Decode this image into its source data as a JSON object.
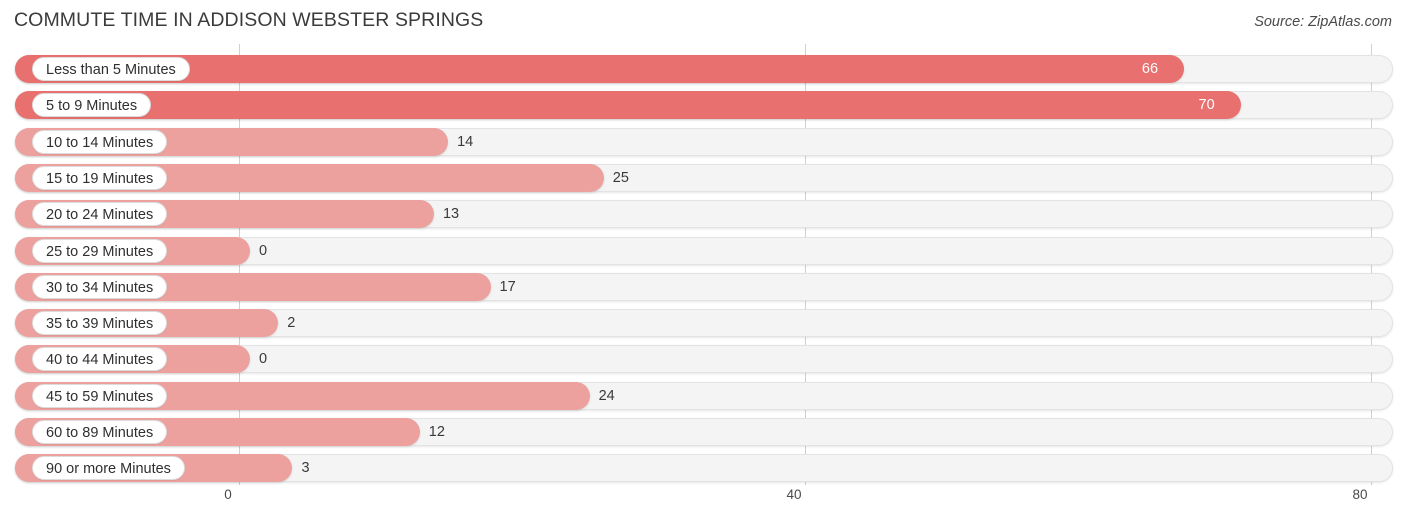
{
  "header": {
    "title": "COMMUTE TIME IN ADDISON WEBSTER SPRINGS",
    "source": "Source: ZipAtlas.com"
  },
  "colors": {
    "bar_light": "#eda19e",
    "bar_dark": "#e8706e",
    "track": "#f4f4f4",
    "gridline": "#d0d0d0",
    "label_text": "#2f2f2f",
    "value_text": "#3a3a3a",
    "value_text_inside": "#ffffff"
  },
  "axis": {
    "ticks": [
      "0",
      "40",
      "80"
    ],
    "min": 0,
    "max": 80
  },
  "chart_data": {
    "type": "bar",
    "orientation": "horizontal",
    "title": "COMMUTE TIME IN ADDISON WEBSTER SPRINGS",
    "subtitle": "Source: ZipAtlas.com",
    "xlabel": "",
    "ylabel": "",
    "xlim": [
      0,
      80
    ],
    "xticks": [
      0,
      40,
      80
    ],
    "grid": true,
    "legend": "none",
    "categories": [
      "Less than 5 Minutes",
      "5 to 9 Minutes",
      "10 to 14 Minutes",
      "15 to 19 Minutes",
      "20 to 24 Minutes",
      "25 to 29 Minutes",
      "30 to 34 Minutes",
      "35 to 39 Minutes",
      "40 to 44 Minutes",
      "45 to 59 Minutes",
      "60 to 89 Minutes",
      "90 or more Minutes"
    ],
    "values": [
      66,
      70,
      14,
      25,
      13,
      0,
      17,
      2,
      0,
      24,
      12,
      3
    ],
    "labels": [
      "66",
      "70",
      "14",
      "25",
      "13",
      "0",
      "17",
      "2",
      "0",
      "24",
      "12",
      "3"
    ]
  },
  "rows": [
    {
      "label": "Less than 5 Minutes",
      "value": 66,
      "value_label": "66",
      "shade": "dark",
      "label_inside": true
    },
    {
      "label": "5 to 9 Minutes",
      "value": 70,
      "value_label": "70",
      "shade": "dark",
      "label_inside": true
    },
    {
      "label": "10 to 14 Minutes",
      "value": 14,
      "value_label": "14",
      "shade": "light",
      "label_inside": false
    },
    {
      "label": "15 to 19 Minutes",
      "value": 25,
      "value_label": "25",
      "shade": "light",
      "label_inside": false
    },
    {
      "label": "20 to 24 Minutes",
      "value": 13,
      "value_label": "13",
      "shade": "light",
      "label_inside": false
    },
    {
      "label": "25 to 29 Minutes",
      "value": 0,
      "value_label": "0",
      "shade": "light",
      "label_inside": false
    },
    {
      "label": "30 to 34 Minutes",
      "value": 17,
      "value_label": "17",
      "shade": "light",
      "label_inside": false
    },
    {
      "label": "35 to 39 Minutes",
      "value": 2,
      "value_label": "2",
      "shade": "light",
      "label_inside": false
    },
    {
      "label": "40 to 44 Minutes",
      "value": 0,
      "value_label": "0",
      "shade": "light",
      "label_inside": false
    },
    {
      "label": "45 to 59 Minutes",
      "value": 24,
      "value_label": "24",
      "shade": "light",
      "label_inside": false
    },
    {
      "label": "60 to 89 Minutes",
      "value": 12,
      "value_label": "12",
      "shade": "light",
      "label_inside": false
    },
    {
      "label": "90 or more Minutes",
      "value": 3,
      "value_label": "3",
      "shade": "light",
      "label_inside": false
    }
  ]
}
